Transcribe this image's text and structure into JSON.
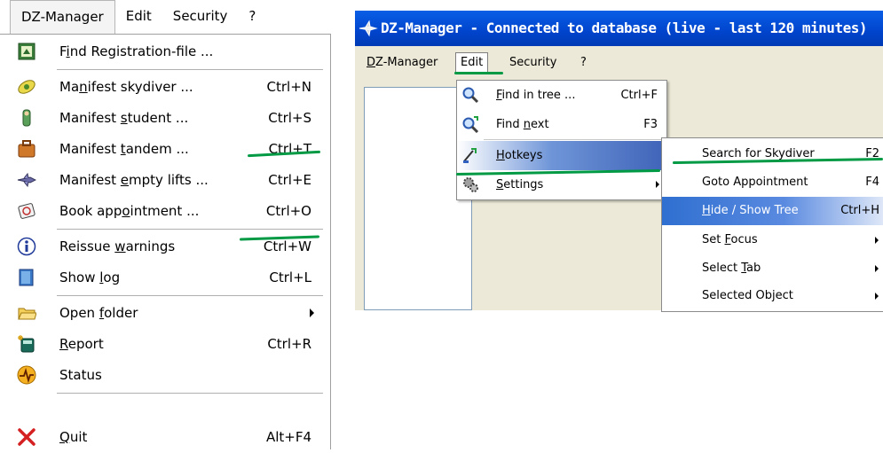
{
  "left_menu": {
    "menubar": [
      "DZ-Manager",
      "Edit",
      "Security",
      "?"
    ],
    "items": [
      {
        "pre": "F",
        "u": "i",
        "post": "nd Registration-file ...",
        "key": "",
        "icon": "registration-file-icon"
      },
      {
        "pre": "Ma",
        "u": "n",
        "post": "ifest skydiver ...",
        "key": "Ctrl+N",
        "icon": "skydiver-icon"
      },
      {
        "pre": "Manifest ",
        "u": "s",
        "post": "tudent ...",
        "key": "Ctrl+S",
        "icon": "student-icon"
      },
      {
        "pre": "Manifest ",
        "u": "t",
        "post": "andem ...",
        "key": "Ctrl+T",
        "icon": "tandem-icon"
      },
      {
        "pre": "Manifest ",
        "u": "e",
        "post": "mpty lifts ...",
        "key": "Ctrl+E",
        "icon": "empty-lifts-icon"
      },
      {
        "pre": "Book app",
        "u": "o",
        "post": "intment ...",
        "key": "Ctrl+O",
        "icon": "appointment-icon"
      },
      {
        "pre": "Reissue ",
        "u": "w",
        "post": "arnings",
        "key": "Ctrl+W",
        "icon": "info-icon"
      },
      {
        "pre": "Show ",
        "u": "l",
        "post": "og",
        "key": "Ctrl+L",
        "icon": "log-icon"
      },
      {
        "pre": "Open ",
        "u": "f",
        "post": "older",
        "key": "",
        "icon": "folder-icon",
        "submenu": true
      },
      {
        "pre": "",
        "u": "R",
        "post": "eport",
        "key": "Ctrl+R",
        "icon": "report-icon"
      },
      {
        "pre": "Status",
        "u": "",
        "post": "",
        "key": "",
        "icon": "status-icon"
      },
      {
        "pre": "",
        "u": "Q",
        "post": "uit",
        "key": "Alt+F4",
        "icon": "quit-icon"
      }
    ]
  },
  "window": {
    "title": "DZ-Manager - Connected to database  (live - last 120 minutes)",
    "menubar": [
      {
        "pre": "",
        "u": "D",
        "post": "Z-Manager"
      },
      {
        "pre": "Edit",
        "u": "",
        "post": ""
      },
      {
        "pre": "Security",
        "u": "",
        "post": ""
      },
      {
        "pre": "?",
        "u": "",
        "post": ""
      }
    ]
  },
  "edit_menu": {
    "items": [
      {
        "pre": "",
        "u": "F",
        "post": "ind in tree ...",
        "key": "Ctrl+F",
        "icon": "magnifier-icon"
      },
      {
        "pre": "Find ",
        "u": "n",
        "post": "ext",
        "key": "F3",
        "icon": "find-next-icon"
      },
      {
        "pre": "",
        "u": "H",
        "post": "otkeys",
        "key": "",
        "icon": "hotkeys-icon",
        "highlight": true
      },
      {
        "pre": "",
        "u": "S",
        "post": "ettings",
        "key": "",
        "icon": "settings-icon",
        "submenu": true
      }
    ]
  },
  "hotkeys_submenu": {
    "items": [
      {
        "pre": "Search for Skydiver",
        "u": "",
        "post": "",
        "key": "F2"
      },
      {
        "pre": "Goto Appointment",
        "u": "",
        "post": "",
        "key": "F4"
      },
      {
        "pre": "",
        "u": "H",
        "post": "ide / Show Tree",
        "key": "Ctrl+H",
        "highlight": true
      },
      {
        "pre": "Set ",
        "u": "F",
        "post": "ocus",
        "key": "",
        "submenu": true
      },
      {
        "pre": "Select ",
        "u": "T",
        "post": "ab",
        "key": "",
        "submenu": true
      },
      {
        "pre": "Selected Object",
        "u": "",
        "post": "",
        "key": "",
        "submenu": true
      }
    ]
  },
  "colors": {
    "highlight_line": "#009944",
    "title_bar": "#0044cc",
    "menu_bg": "#ece9d8"
  }
}
